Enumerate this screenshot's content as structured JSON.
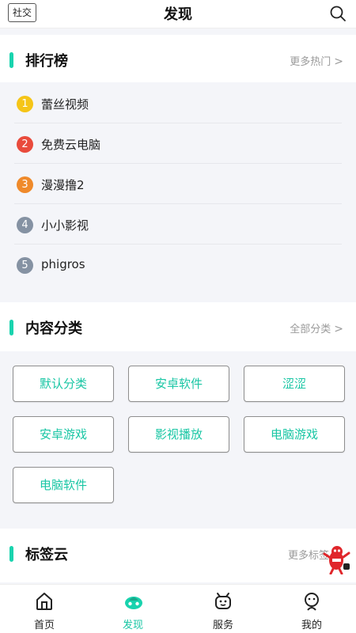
{
  "header": {
    "social_label": "社交",
    "title": "发现"
  },
  "ranking": {
    "title": "排行榜",
    "more_label": "更多热门",
    "items": [
      {
        "rank": "1",
        "name": "蕾丝视频",
        "color": "#f5c518"
      },
      {
        "rank": "2",
        "name": "免费云电脑",
        "color": "#e94b3c"
      },
      {
        "rank": "3",
        "name": "漫漫撸2",
        "color": "#ef8a2b"
      },
      {
        "rank": "4",
        "name": "小小影视",
        "color": "#8592a3"
      },
      {
        "rank": "5",
        "name": "phigros",
        "color": "#8592a3"
      }
    ]
  },
  "categories": {
    "title": "内容分类",
    "more_label": "全部分类",
    "items": [
      "默认分类",
      "安卓软件",
      "涩涩",
      "安卓游戏",
      "影视播放",
      "电脑游戏",
      "电脑软件"
    ]
  },
  "tags": {
    "title": "标签云",
    "more_label": "更多标签"
  },
  "tabbar": {
    "items": [
      {
        "label": "首页",
        "icon": "home-icon"
      },
      {
        "label": "发现",
        "icon": "discover-icon",
        "active": true
      },
      {
        "label": "服务",
        "icon": "service-icon"
      },
      {
        "label": "我的",
        "icon": "profile-icon"
      }
    ]
  },
  "colors": {
    "accent": "#19d3ae",
    "accent_text": "#19c6a4",
    "background": "#f4f5f9"
  }
}
